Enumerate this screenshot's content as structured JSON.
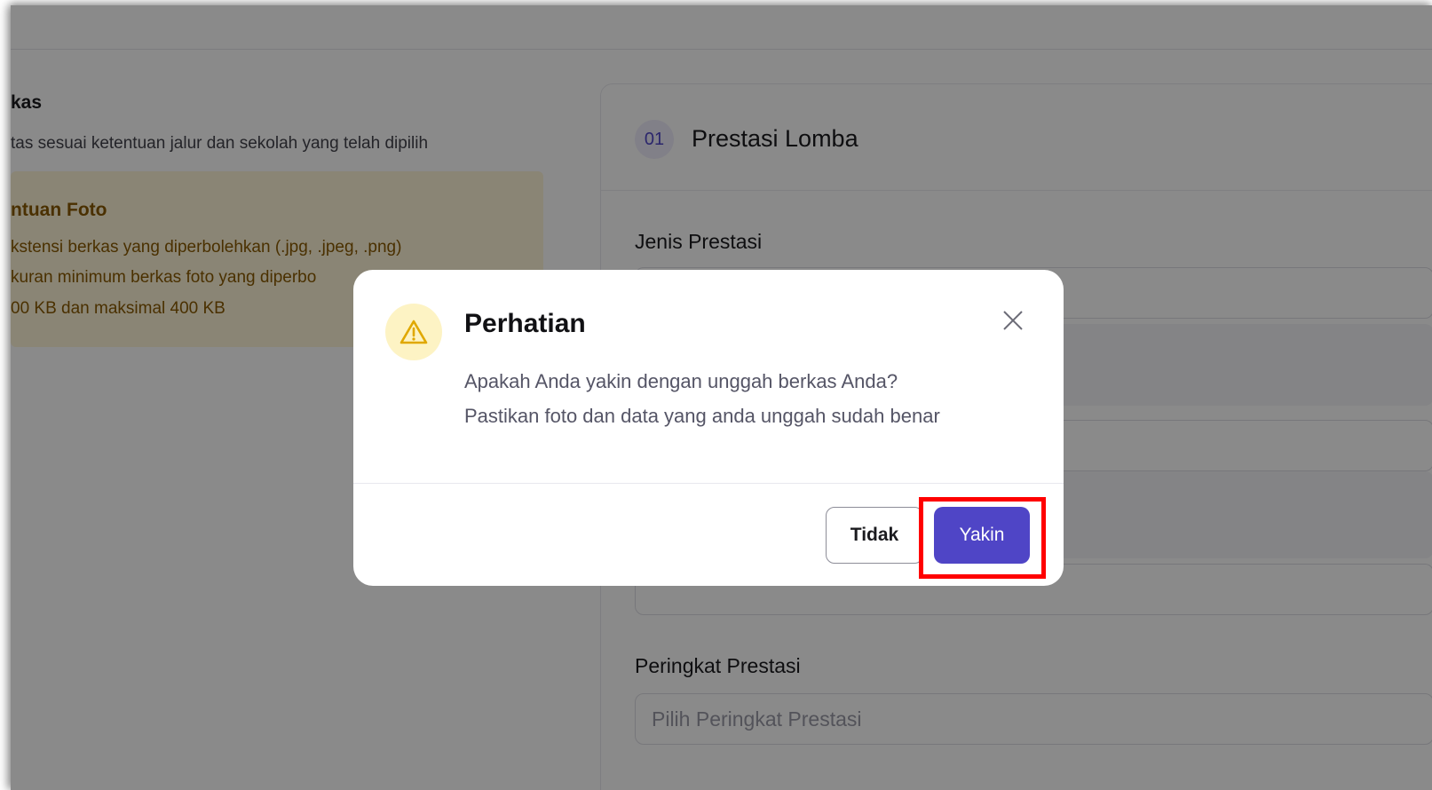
{
  "background": {
    "left_section": {
      "title": "kas",
      "subtitle": "tas sesuai ketentuan jalur dan sekolah yang telah dipilih",
      "info": {
        "title": "ntuan Foto",
        "lines": [
          "kstensi berkas yang diperbolehkan (.jpg, .jpeg, .png)",
          "kuran minimum berkas foto yang diperbo",
          "00 KB dan maksimal 400 KB"
        ]
      }
    },
    "card": {
      "step": "01",
      "title": "Prestasi Lomba",
      "field1_label": "Jenis Prestasi",
      "field2_label": "Peringkat Prestasi",
      "field2_placeholder": "Pilih Peringkat Prestasi"
    }
  },
  "modal": {
    "icon": "warning-icon",
    "title": "Perhatian",
    "message_line1": "Apakah Anda yakin dengan unggah berkas Anda?",
    "message_line2": "Pastikan foto dan data yang anda unggah sudah benar",
    "cancel_label": "Tidak",
    "confirm_label": "Yakin"
  },
  "colors": {
    "primary": "#4f45c6",
    "warning_bg": "#fdf3c4",
    "warning_icon": "#e0a800",
    "highlight": "#ff0000",
    "info_text": "#8a5a00",
    "info_bg": "#fff6d8"
  }
}
